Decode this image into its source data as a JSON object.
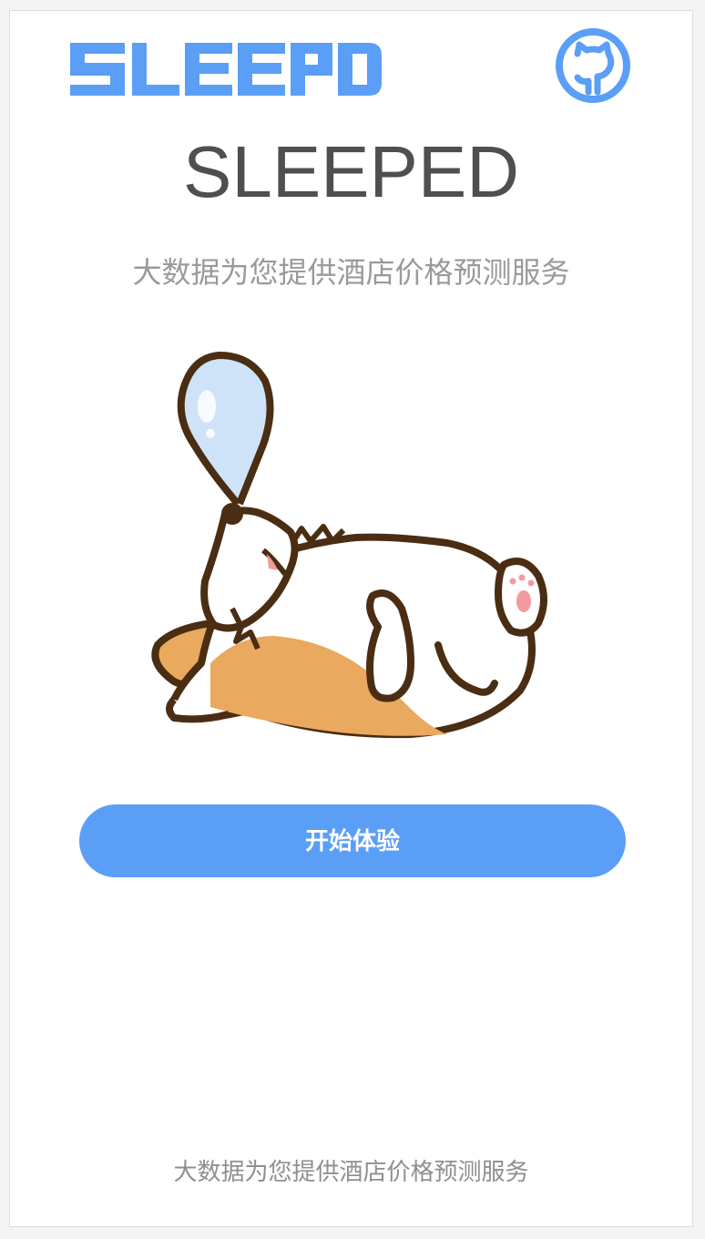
{
  "brand": {
    "logo_text": "SLEEPED",
    "accent_color": "#5b9ef6"
  },
  "header": {
    "github_icon": "github-octocat-icon"
  },
  "main": {
    "title": "SLEEPED",
    "subtitle": "大数据为您提供酒店价格预测服务",
    "illustration": "sleeping-corgi-illustration",
    "cta_label": "开始体验"
  },
  "footer": {
    "text": "大数据为您提供酒店价格预测服务"
  }
}
